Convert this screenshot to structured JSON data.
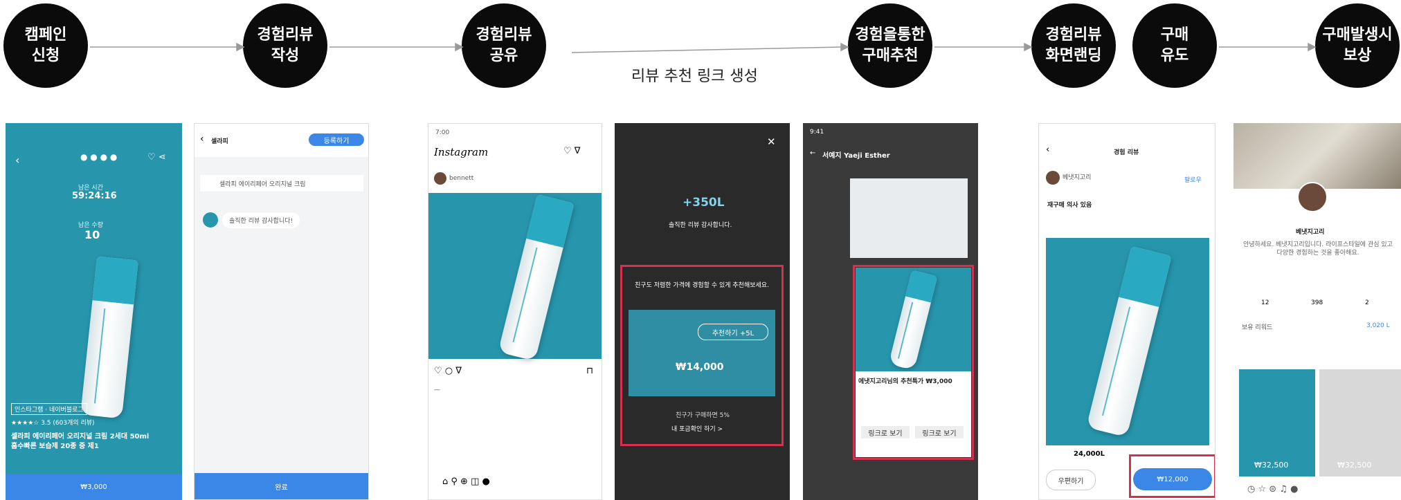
{
  "steps": [
    {
      "label": "캠페인\n신청"
    },
    {
      "label": "경험리뷰\n작성"
    },
    {
      "label": "경험리뷰\n공유"
    },
    {
      "label": "경험을통한\n구매추천"
    },
    {
      "label": "경험리뷰\n화면랜딩"
    },
    {
      "label": "구매\n유도"
    },
    {
      "label": "구매발생시\n보상"
    }
  ],
  "link_caption": "리뷰 추천 링크 생성",
  "screens": {
    "campaign": {
      "timer_label": "남은 시간",
      "timer": "59:24:16",
      "count_label": "남은 수량",
      "count": "10",
      "rating": "★★★★☆ 3.5 (603개의 리뷰)",
      "product_title": "셀라피 에이리페어 오리지널 크림 2세대 50ml",
      "product_sub": "홈수빠른 보습제 20종 중 제1",
      "price": "₩3,000"
    },
    "write": {
      "title": "셀라피",
      "submit": "등록하기",
      "product": "셀라피 에이리페어 오리지널 크림",
      "thanks": "솔직한 리뷰 감사합니다!",
      "done": "완료"
    },
    "instagram": {
      "time": "7:00",
      "app": "Instagram",
      "user": "bennett"
    },
    "reward": {
      "points": "+350L",
      "thanks": "솔직한 리뷰 감사합니다.",
      "recommend": "친구도 저렴한 가격에 경험할 수 있게 추천해보세요.",
      "recommend_btn": "추천하기 +5L",
      "price": "₩14,000",
      "note": "친구가 구매하면 5%",
      "link": "내 포금확인 하기 >"
    },
    "chat": {
      "time": "9:41",
      "chat_title": "서예지 Yaeji Esther",
      "card_title": "에냇지고리님의 추천특가 ₩3,000",
      "btn_view": "링크로 보기",
      "btn_buy": "링크로 보기"
    },
    "review": {
      "title": "경험 리뷰",
      "reviewer": "베냇지고리",
      "follow": "팔로우",
      "headline": "재구매 의사 있음",
      "price_tag": "24,000L",
      "share": "우편하기",
      "buy_price": "₩12,000"
    },
    "profile": {
      "name": "베냇지고리",
      "intro": "안녕하세요. 베냇지고리입니다. 라이프스타일에 관심 있고 다양한 경험하는 것을 좋아해요.",
      "stats": [
        "12",
        "398",
        "2"
      ],
      "reward_label": "보유 리워드",
      "reward_value": "3,020 L",
      "price1": "₩32,500",
      "price2": "₩32,500"
    }
  },
  "colors": {
    "accent": "#3b87e8",
    "highlight": "#d6304f",
    "teal": "#2796ad"
  }
}
